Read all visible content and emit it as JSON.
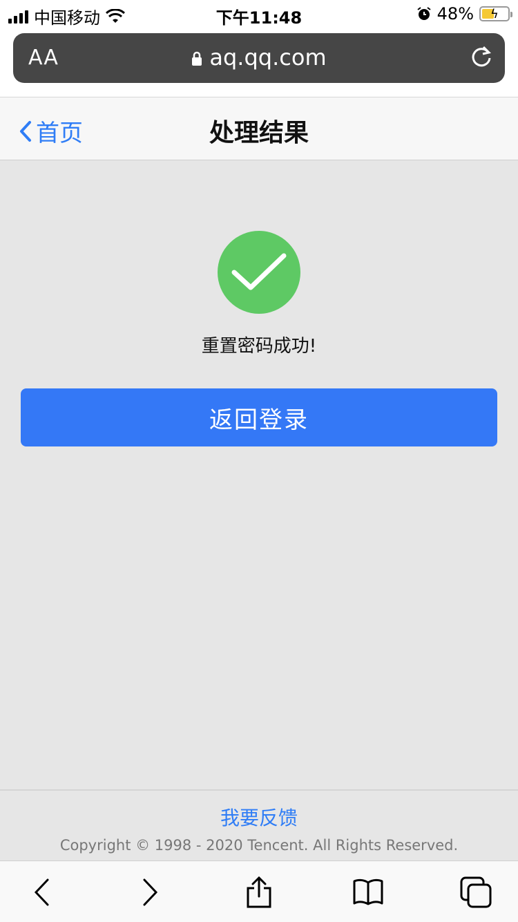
{
  "status_bar": {
    "carrier": "中国移动",
    "time": "下午11:48",
    "battery_percent": "48%",
    "battery_level": 0.48
  },
  "url_bar": {
    "text_size_label": "AA",
    "url": "aq.qq.com"
  },
  "nav": {
    "back_label": "首页",
    "title": "处理结果"
  },
  "result": {
    "message": "重置密码成功!",
    "button_label": "返回登录",
    "success_color": "#5ec964"
  },
  "footer": {
    "feedback_link": "我要反馈",
    "copyright": "Copyright © 1998 - 2020 Tencent. All Rights Reserved."
  },
  "toolbar": {
    "icons": [
      "back-icon",
      "forward-icon",
      "share-icon",
      "bookmarks-icon",
      "tabs-icon"
    ]
  },
  "colors": {
    "accent": "#3478f6",
    "link": "#2f7df6",
    "background": "#e6e6e6"
  }
}
